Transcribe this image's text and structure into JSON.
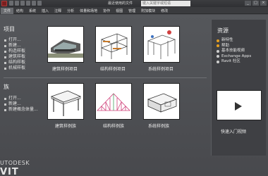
{
  "window": {
    "doc_title": "最近使用的文件",
    "search_placeholder": "键入关键字或短语",
    "controls": [
      "_",
      "□",
      "×"
    ]
  },
  "menu": [
    "文件",
    "结构",
    "系统",
    "插入",
    "注释",
    "分析",
    "体量和场地",
    "协作",
    "视图",
    "管理",
    "附加模块",
    "修改"
  ],
  "projects": {
    "title": "项目",
    "links": [
      "打开...",
      "新建...",
      "构造样板",
      "建筑样板",
      "结构样板",
      "机械样板"
    ],
    "thumbs": [
      "建筑样例项目",
      "结构样例项目",
      "系统样例项目"
    ]
  },
  "families": {
    "title": "族",
    "links": [
      "打开...",
      "新建...",
      "新建概念体量..."
    ],
    "thumbs": [
      "建筑样例族",
      "结构样例族",
      "系统样例族"
    ]
  },
  "resources": {
    "title": "资源",
    "items": [
      "新特性",
      "帮助",
      "基本技能视频",
      "Exchange Apps",
      "Ravit 社区"
    ],
    "video_label": "快速入门视频"
  },
  "brand": {
    "line1": "UTODESK",
    "line2": "VIT"
  }
}
